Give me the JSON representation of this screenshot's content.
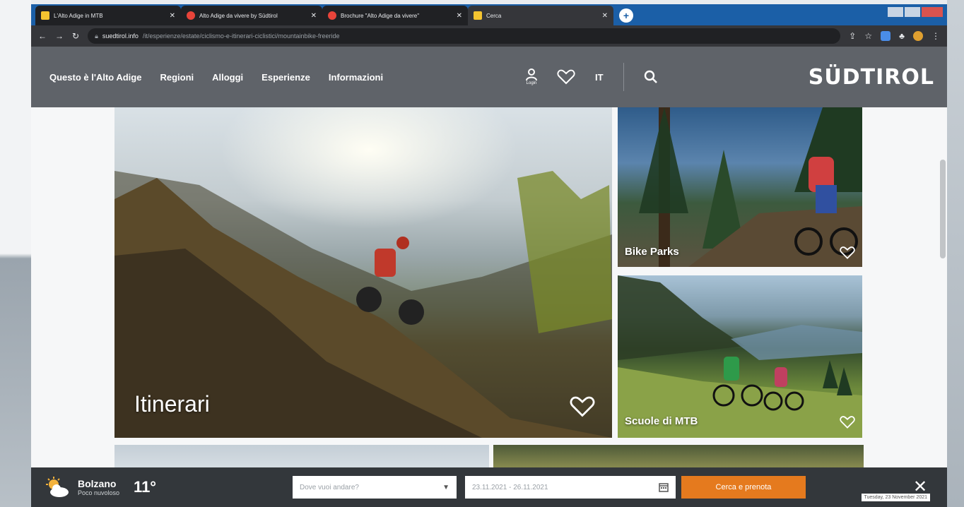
{
  "tabs": [
    {
      "title": "L'Alto Adige in MTB",
      "favicon": "yellow"
    },
    {
      "title": "Alto Adige da vivere by Südtirol",
      "favicon": "red"
    },
    {
      "title": "Brochure \"Alto Adige da vivere\"",
      "favicon": "red"
    },
    {
      "title": "Cerca",
      "favicon": "yellow"
    }
  ],
  "address": {
    "host": "suedtirol.info",
    "path": "/it/esperienze/estate/ciclismo-e-itinerari-ciclistici/mountainbike-freeride"
  },
  "nav": {
    "items": [
      "Questo è l'Alto Adige",
      "Regioni",
      "Alloggi",
      "Esperienze",
      "Informazioni"
    ],
    "login_label": "Login",
    "lang": "IT",
    "logo": "SÜDTIROL"
  },
  "tiles": {
    "main": "Itinerari",
    "bike_parks": "Bike Parks",
    "scuole": "Scuole di MTB"
  },
  "bottombar": {
    "city": "Bolzano",
    "condition": "Poco nuvoloso",
    "temperature": "11°",
    "destination_placeholder": "Dove vuoi andare?",
    "dates": "23.11.2021 - 26.11.2021",
    "search_label": "Cerca e prenota",
    "close_label": "✕",
    "clock": "Tuesday, 23 November 2021"
  },
  "colors": {
    "header_bg": "#5f6369",
    "accent_orange": "#e57a1e",
    "bottombar_bg": "#33373b"
  }
}
